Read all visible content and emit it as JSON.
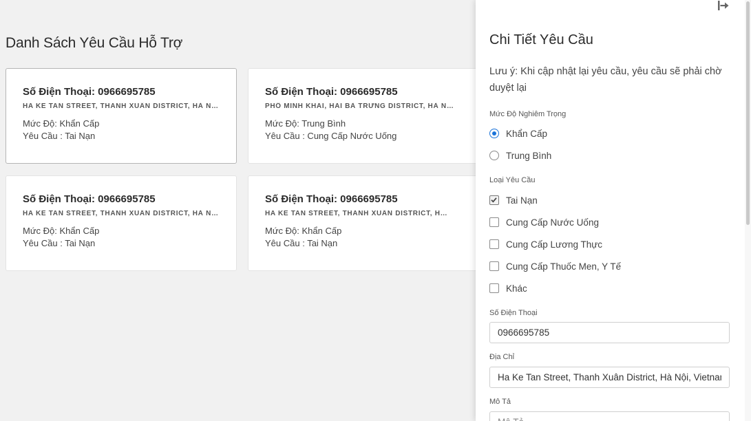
{
  "page": {
    "title": "Danh Sách Yêu Cầu Hỗ Trợ"
  },
  "requests": [
    {
      "phone": "Số Điện Thoại: 0966695785",
      "address": "HA KE TAN STREET, THANH XUÂN DISTRICT, HÀ NỘI, VIETNAM",
      "level": "Mức Độ: Khẩn Cấp",
      "type": "Yêu Cầu : Tai Nạn"
    },
    {
      "phone": "Số Điện Thoại: 0966695785",
      "address": "PHỐ MINH KHAI, HAI BÀ TRƯNG DISTRICT, HÀ NỘI, VIETNAM",
      "level": "Mức Độ: Trung Bình",
      "type": "Yêu Cầu : Cung Cấp Nước Uống"
    },
    {
      "phone": "Số Điện Thoại: 0966695785",
      "address": "HA KE TAN STREET, THANH XUÂN DISTRICT, HÀ NỘI, VIETNAM",
      "level": "Mức Độ: Khẩn Cấp",
      "type": "Yêu Cầu : Tai Nạn"
    },
    {
      "phone": "Số Điện Thoại: 0966695785",
      "address": "HA KE TAN STREET, THANH XUÂN DISTRICT, HÀ NỘI, VIETNAM",
      "level": "Mức Độ: Khẩn Cấp",
      "type": "Yêu Cầu : Tai Nạn"
    }
  ],
  "panel": {
    "title": "Chi Tiết Yêu Cầu",
    "note": "Lưu ý: Khi cập nhật lại yêu cầu, yêu cầu sẽ phải chờ duyệt lại",
    "exit_icon": "exit-icon",
    "severity": {
      "label": "Mức Độ Nghiêm Trọng",
      "options": [
        {
          "label": "Khẩn Cấp",
          "selected": true
        },
        {
          "label": "Trung Bình",
          "selected": false
        }
      ]
    },
    "request_type": {
      "label": "Loại Yêu Cầu",
      "options": [
        {
          "label": "Tai Nạn",
          "checked": true
        },
        {
          "label": "Cung Cấp Nước Uống",
          "checked": false
        },
        {
          "label": "Cung Cấp Lương Thực",
          "checked": false
        },
        {
          "label": "Cung Cấp Thuốc Men, Y Tế",
          "checked": false
        },
        {
          "label": "Khác",
          "checked": false
        }
      ]
    },
    "phone_field": {
      "label": "Số Điện Thoại",
      "value": "0966695785"
    },
    "address_field": {
      "label": "Địa Chỉ",
      "value": "Ha Ke Tan Street, Thanh Xuân District, Hà Nội, Vietnam"
    },
    "description_field": {
      "label": "Mô Tả",
      "placeholder": "Mô Tả"
    }
  },
  "colors": {
    "accent": "#1a73d9",
    "background": "#f1f1f1",
    "card": "#ffffff"
  }
}
